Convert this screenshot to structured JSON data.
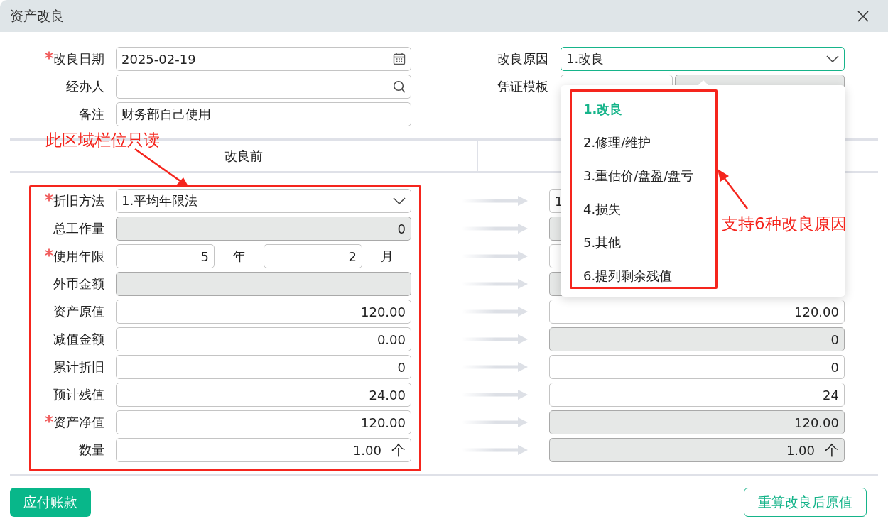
{
  "dialog": {
    "title": "资产改良"
  },
  "form_left": [
    {
      "kind": "date",
      "label": "改良日期",
      "required": true,
      "value": "2025-02-19"
    },
    {
      "kind": "search",
      "label": "经办人",
      "required": false
    },
    {
      "kind": "text",
      "label": "备注",
      "required": false,
      "value": "财务部自己使用"
    }
  ],
  "form_right": [
    {
      "kind": "select",
      "label": "改良原因",
      "value": "1.改良",
      "focused": true
    },
    {
      "kind": "template",
      "label": "凭证模板"
    }
  ],
  "compare": {
    "before_heading": "改良前",
    "rows": [
      {
        "kind": "select",
        "label": "折旧方法",
        "required": true,
        "before": {
          "value": "1.平均年限法",
          "readonly": false
        },
        "after": {
          "value": "1",
          "readonly": false
        }
      },
      {
        "kind": "number",
        "label": "总工作量",
        "required": false,
        "before": {
          "value": "0",
          "readonly": true
        },
        "after": {
          "readonly": true
        }
      },
      {
        "kind": "years",
        "label": "使用年限",
        "required": true,
        "before": {
          "years": "5",
          "year_unit": "年",
          "months": "2",
          "month_unit": "月",
          "readonly": false
        },
        "after": {
          "readonly": false
        }
      },
      {
        "kind": "number",
        "label": "外币金额",
        "required": false,
        "before": {
          "readonly": true
        },
        "after": {
          "readonly": true
        }
      },
      {
        "kind": "number",
        "label": "资产原值",
        "required": false,
        "before": {
          "value": "120.00",
          "readonly": false
        },
        "after": {
          "value": "120.00",
          "readonly": false
        }
      },
      {
        "kind": "number",
        "label": "减值金额",
        "required": false,
        "before": {
          "value": "0.00",
          "readonly": false
        },
        "after": {
          "value": "0",
          "readonly": true
        }
      },
      {
        "kind": "number",
        "label": "累计折旧",
        "required": false,
        "before": {
          "value": "0",
          "readonly": false
        },
        "after": {
          "value": "0",
          "readonly": false
        }
      },
      {
        "kind": "number",
        "label": "预计残值",
        "required": false,
        "before": {
          "value": "24.00",
          "readonly": false
        },
        "after": {
          "value": "24",
          "readonly": false
        }
      },
      {
        "kind": "number",
        "label": "资产净值",
        "required": true,
        "before": {
          "value": "120.00",
          "readonly": false
        },
        "after": {
          "value": "120.00",
          "readonly": true
        }
      },
      {
        "kind": "number",
        "label": "数量",
        "required": false,
        "before": {
          "value": "1.00",
          "unit": "个",
          "readonly": false
        },
        "after": {
          "value": "1.00",
          "unit": "个",
          "readonly": true
        }
      }
    ]
  },
  "reason_dropdown": {
    "options": [
      {
        "label": "1.改良",
        "selected": true
      },
      {
        "label": "2.修理/维护",
        "selected": false
      },
      {
        "label": "3.重估价/盘盈/盘亏",
        "selected": false
      },
      {
        "label": "4.损失",
        "selected": false
      },
      {
        "label": "5.其他",
        "selected": false
      },
      {
        "label": "6.提列剩余残值",
        "selected": false
      }
    ]
  },
  "annotations": [
    {
      "kind": "readonly_note",
      "text": "此区域栏位只读"
    },
    {
      "kind": "reasons_note",
      "text": "支持6种改良原因"
    }
  ],
  "buttons": [
    {
      "kind": "primary",
      "label": "应付账款"
    },
    {
      "kind": "outline",
      "label": "重算改良后原值"
    }
  ]
}
